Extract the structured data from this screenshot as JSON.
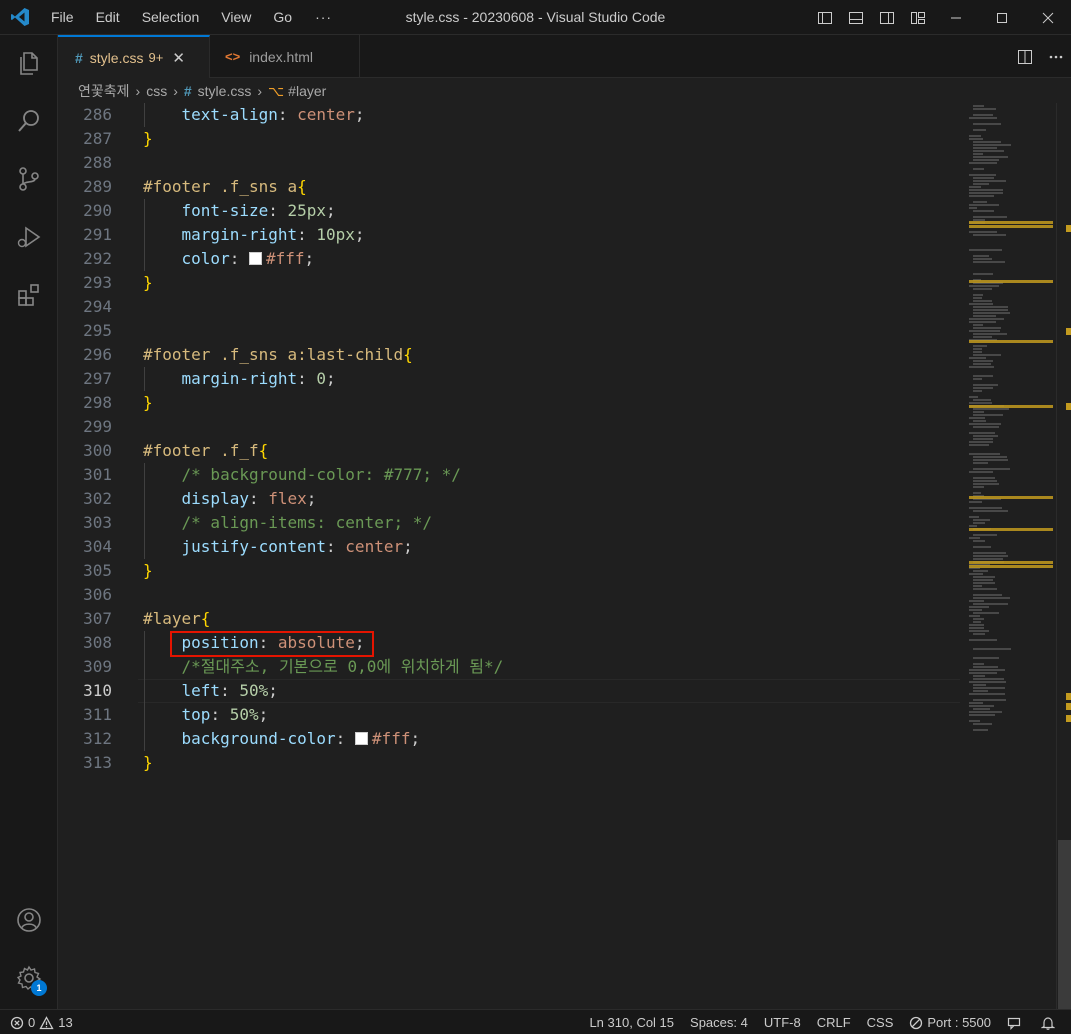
{
  "titlebar": {
    "menu": [
      "File",
      "Edit",
      "Selection",
      "View",
      "Go"
    ],
    "more": "···",
    "title": "style.css - 20230608 - Visual Studio Code"
  },
  "tabs": [
    {
      "label": "style.css",
      "problems": "9+",
      "active": true,
      "icon": "css-hash-icon"
    },
    {
      "label": "index.html",
      "active": false,
      "icon": "html-icon"
    }
  ],
  "breadcrumb": {
    "folder1": "연꽃축제",
    "folder2": "css",
    "file": "style.css",
    "symbol": "#layer"
  },
  "editor": {
    "current_line": 310,
    "lines": [
      {
        "n": "286",
        "code": "text-align: center;"
      },
      {
        "n": "287",
        "code": "}"
      },
      {
        "n": "288",
        "code": ""
      },
      {
        "n": "289",
        "code": "#footer .f_sns a{"
      },
      {
        "n": "290",
        "code": "font-size: 25px;"
      },
      {
        "n": "291",
        "code": "margin-right: 10px;"
      },
      {
        "n": "292",
        "code": "color: #fff;"
      },
      {
        "n": "293",
        "code": "}"
      },
      {
        "n": "294",
        "code": ""
      },
      {
        "n": "295",
        "code": ""
      },
      {
        "n": "296",
        "code": "#footer .f_sns a:last-child{"
      },
      {
        "n": "297",
        "code": "margin-right: 0;"
      },
      {
        "n": "298",
        "code": "}"
      },
      {
        "n": "299",
        "code": ""
      },
      {
        "n": "300",
        "code": "#footer .f_f{"
      },
      {
        "n": "301",
        "code": "/* background-color: #777; */"
      },
      {
        "n": "302",
        "code": "display: flex;"
      },
      {
        "n": "303",
        "code": "/* align-items: center; */"
      },
      {
        "n": "304",
        "code": "justify-content: center;"
      },
      {
        "n": "305",
        "code": "}"
      },
      {
        "n": "306",
        "code": ""
      },
      {
        "n": "307",
        "code": "#layer{"
      },
      {
        "n": "308",
        "code": "position: absolute;"
      },
      {
        "n": "309",
        "code": "/*절대주소, 기본으로 0,0에 위치하게 됨*/"
      },
      {
        "n": "310",
        "code": "left: 50%;"
      },
      {
        "n": "311",
        "code": "top: 50%;"
      },
      {
        "n": "312",
        "code": "background-color: #fff;"
      },
      {
        "n": "313",
        "code": "}"
      }
    ],
    "highlight_color": "#e51400"
  },
  "activity": {
    "accounts_badge": "1"
  },
  "statusbar": {
    "errors": "0",
    "warnings": "13",
    "position": "Ln 310, Col 15",
    "spaces": "Spaces: 4",
    "encoding": "UTF-8",
    "eol": "CRLF",
    "language": "CSS",
    "port": "Port : 5500"
  },
  "colors": {
    "accent": "#0078d4",
    "editor_bg": "#1f1f1f",
    "chrome_bg": "#181818"
  }
}
